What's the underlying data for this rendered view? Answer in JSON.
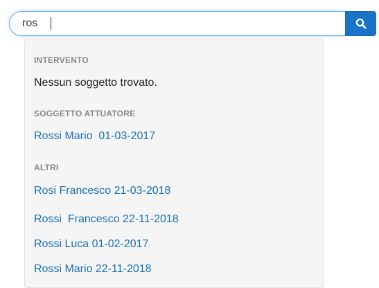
{
  "search": {
    "value": "ros",
    "button_icon": "search-icon"
  },
  "dropdown": {
    "sections": [
      {
        "label": "INTERVENTO",
        "empty_message": "Nessun soggetto trovato."
      },
      {
        "label": "SOGGETTO ATTUATORE",
        "items": [
          "Rossi Mario  01-03-2017"
        ]
      },
      {
        "label": "ALTRI",
        "items": [
          "Rosi Francesco 21-03-2018",
          "Rossi  Francesco 22-11-2018",
          "Rossi Luca 01-02-2017",
          "Rossi Mario 22-11-2018"
        ]
      }
    ]
  },
  "colors": {
    "accent": "#1a73c8",
    "link": "#1a6fb5",
    "section_label": "#888888",
    "dropdown_bg": "#f5f5f5"
  }
}
